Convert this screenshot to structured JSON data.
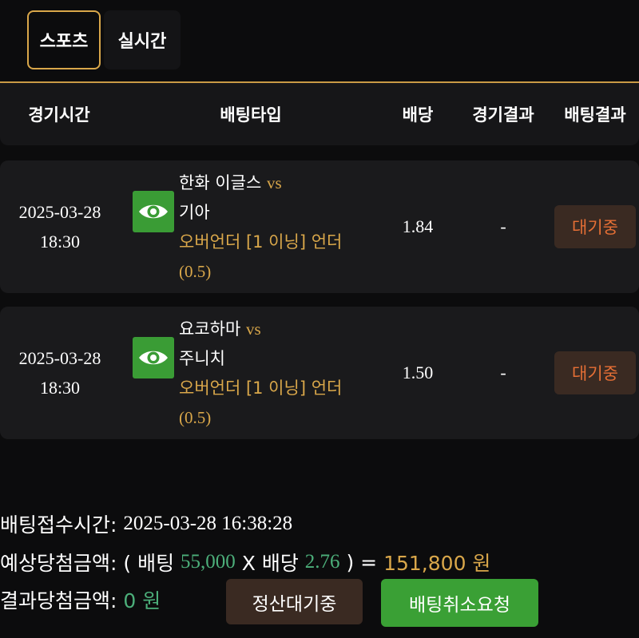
{
  "tabs": [
    {
      "label": "스포츠",
      "active": true
    },
    {
      "label": "실시간",
      "active": false
    }
  ],
  "columns": {
    "time": "경기시간",
    "bet_type": "배팅타입",
    "odds": "배당",
    "game_result": "경기결과",
    "bet_result": "배팅결과"
  },
  "bets": [
    {
      "date": "2025-03-28",
      "time": "18:30",
      "home": "한화 이글스",
      "vs": "vs",
      "away": "기아",
      "market_line1": "오버언더 [1 이닝] 언더",
      "market_line2": "(0.5)",
      "odds": "1.84",
      "game_result": "-",
      "status": "대기중"
    },
    {
      "date": "2025-03-28",
      "time": "18:30",
      "home": "요코하마",
      "vs": "vs",
      "away": "주니치",
      "market_line1": "오버언더 [1 이닝] 언더",
      "market_line2": "(0.5)",
      "odds": "1.50",
      "game_result": "-",
      "status": "대기중"
    }
  ],
  "summary": {
    "received_label": "배팅접수시간:",
    "received_value": "2025-03-28 16:38:28",
    "expected_label": "예상당첨금액:",
    "open_paren": "( 배팅",
    "stake": "55,000",
    "times": "X 배당",
    "total_odds": "2.76",
    "close_eq": ") =",
    "payout": "151,800 원",
    "actual_label": "결과당첨금액:",
    "actual_value": "0 원"
  },
  "buttons": {
    "settle_pending": "정산대기중",
    "cancel_request": "배팅취소요청"
  },
  "colors": {
    "accent_gold": "#d9a74a",
    "green_button": "#3aa035",
    "status_orange": "#e56f35"
  },
  "icons": [
    "eye-icon"
  ]
}
